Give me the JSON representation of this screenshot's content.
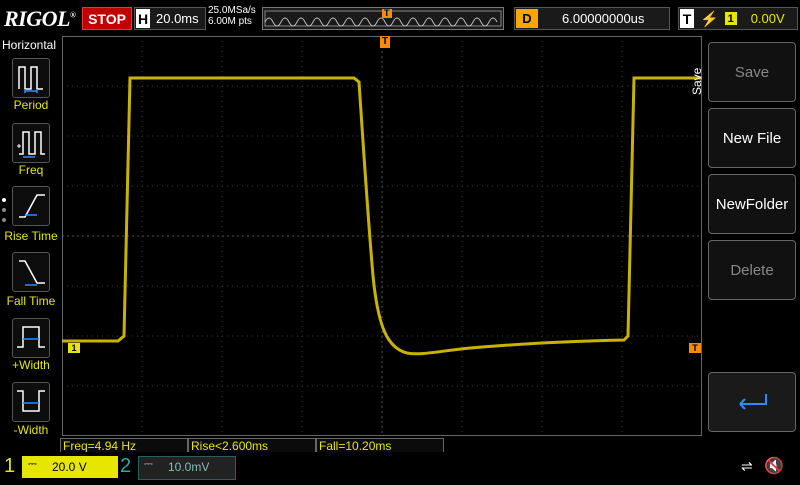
{
  "topbar": {
    "logo": "RIGOL",
    "run_state": "STOP",
    "horizontal_key": "H",
    "timebase": "20.0ms",
    "sample_rate": "25.0MSa/s",
    "memory_points": "6.00M pts",
    "trigger_marker": "T",
    "delay_key": "D",
    "delay_value": "6.00000000us",
    "trigger_key": "T",
    "trigger_source": "1",
    "trigger_level": "0.00V"
  },
  "left_menu": {
    "title": "Horizontal",
    "items": [
      {
        "label": "Period",
        "icon": "period-icon"
      },
      {
        "label": "Freq",
        "icon": "freq-icon"
      },
      {
        "label": "Rise Time",
        "icon": "rise-time-icon"
      },
      {
        "label": "Fall Time",
        "icon": "fall-time-icon"
      },
      {
        "label": "+Width",
        "icon": "pos-width-icon"
      },
      {
        "label": "-Width",
        "icon": "neg-width-icon"
      }
    ]
  },
  "right_menu": {
    "title": "Save",
    "buttons": [
      {
        "label": "Save",
        "enabled": false
      },
      {
        "label": "New File",
        "enabled": true
      },
      {
        "label": "NewFolder",
        "enabled": true
      },
      {
        "label": "Delete",
        "enabled": false
      },
      {
        "label": "",
        "icon": "enter-return-icon",
        "enabled": true
      }
    ]
  },
  "screen": {
    "ch1_marker": "1",
    "trigger_level_marker": "T",
    "top_trigger_marker": "T",
    "trace_color": "#c8b400"
  },
  "measurements": {
    "freq": "Freq=4.94 Hz",
    "rise": "Rise<2.600ms",
    "fall": "Fall=10.20ms"
  },
  "status": {
    "ch1_num": "1",
    "ch1_scale": "20.0 V",
    "ch2_num": "2",
    "ch2_scale": "10.0mV",
    "usb_icon": "usb-icon",
    "mute_icon": "speaker-mute-icon"
  },
  "colors": {
    "ch1": "#e6e600",
    "ch2": "#2aa9a9",
    "stop": "#c00000",
    "delay": "#ffa500"
  }
}
